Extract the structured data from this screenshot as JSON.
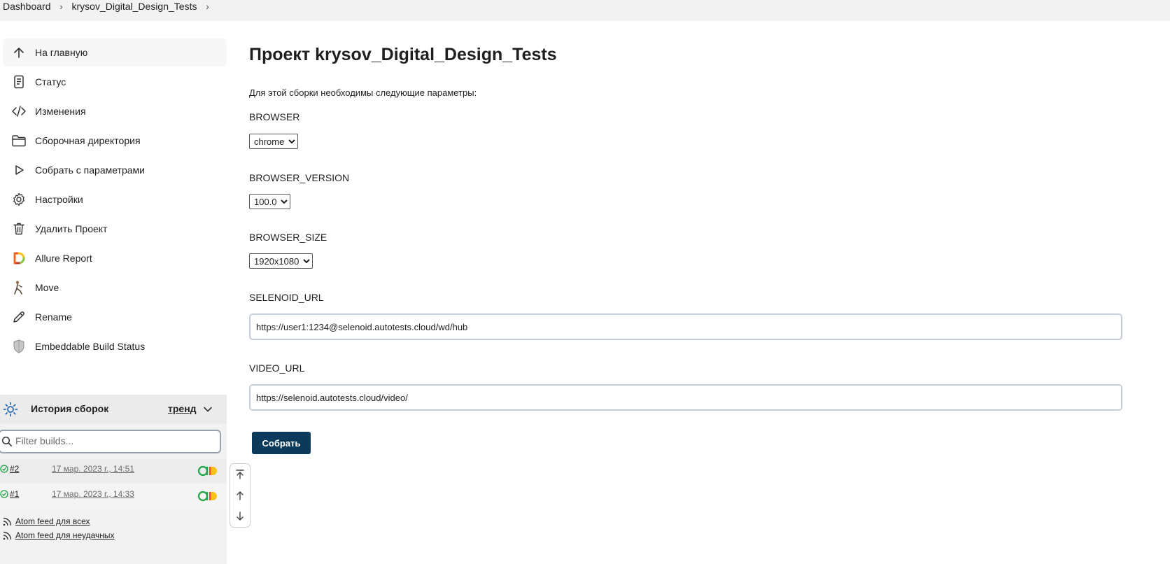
{
  "breadcrumb": {
    "items": [
      "Dashboard",
      "krysov_Digital_Design_Tests"
    ]
  },
  "sidebar": {
    "items": [
      {
        "label": "На главную",
        "icon": "arrow-up-icon"
      },
      {
        "label": "Статус",
        "icon": "document-icon"
      },
      {
        "label": "Изменения",
        "icon": "code-icon"
      },
      {
        "label": "Сборочная директория",
        "icon": "folder-icon"
      },
      {
        "label": "Собрать с параметрами",
        "icon": "play-icon"
      },
      {
        "label": "Настройки",
        "icon": "gear-icon"
      },
      {
        "label": "Удалить Проект",
        "icon": "trash-icon"
      },
      {
        "label": "Allure Report",
        "icon": "allure-icon"
      },
      {
        "label": "Move",
        "icon": "move-icon"
      },
      {
        "label": "Rename",
        "icon": "pencil-icon"
      },
      {
        "label": "Embeddable Build Status",
        "icon": "shield-icon"
      }
    ]
  },
  "history": {
    "title": "История сборок",
    "trend": "тренд",
    "filter_placeholder": "Filter builds...",
    "builds": [
      {
        "number": "#2",
        "date": "17 мар. 2023 г., 14:51",
        "status": "success"
      },
      {
        "number": "#1",
        "date": "17 мар. 2023 г., 14:33",
        "status": "success"
      }
    ],
    "feeds": [
      "Atom feed для всех",
      "Atom feed для неудачных"
    ]
  },
  "main": {
    "title": "Проект krysov_Digital_Design_Tests",
    "description": "Для этой сборки необходимы следующие параметры:",
    "params": {
      "browser": {
        "label": "BROWSER",
        "value": "chrome"
      },
      "browser_version": {
        "label": "BROWSER_VERSION",
        "value": "100.0"
      },
      "browser_size": {
        "label": "BROWSER_SIZE",
        "value": "1920x1080"
      },
      "selenoid_url": {
        "label": "SELENOID_URL",
        "value": "https://user1:1234@selenoid.autotests.cloud/wd/hub"
      },
      "video_url": {
        "label": "VIDEO_URL",
        "value": "https://selenoid.autotests.cloud/video/"
      }
    },
    "build_button": "Собрать"
  },
  "colors": {
    "primary_button": "#0b3a5b",
    "success": "#1ea446",
    "breadcrumb_bg": "#f2f2f2"
  }
}
